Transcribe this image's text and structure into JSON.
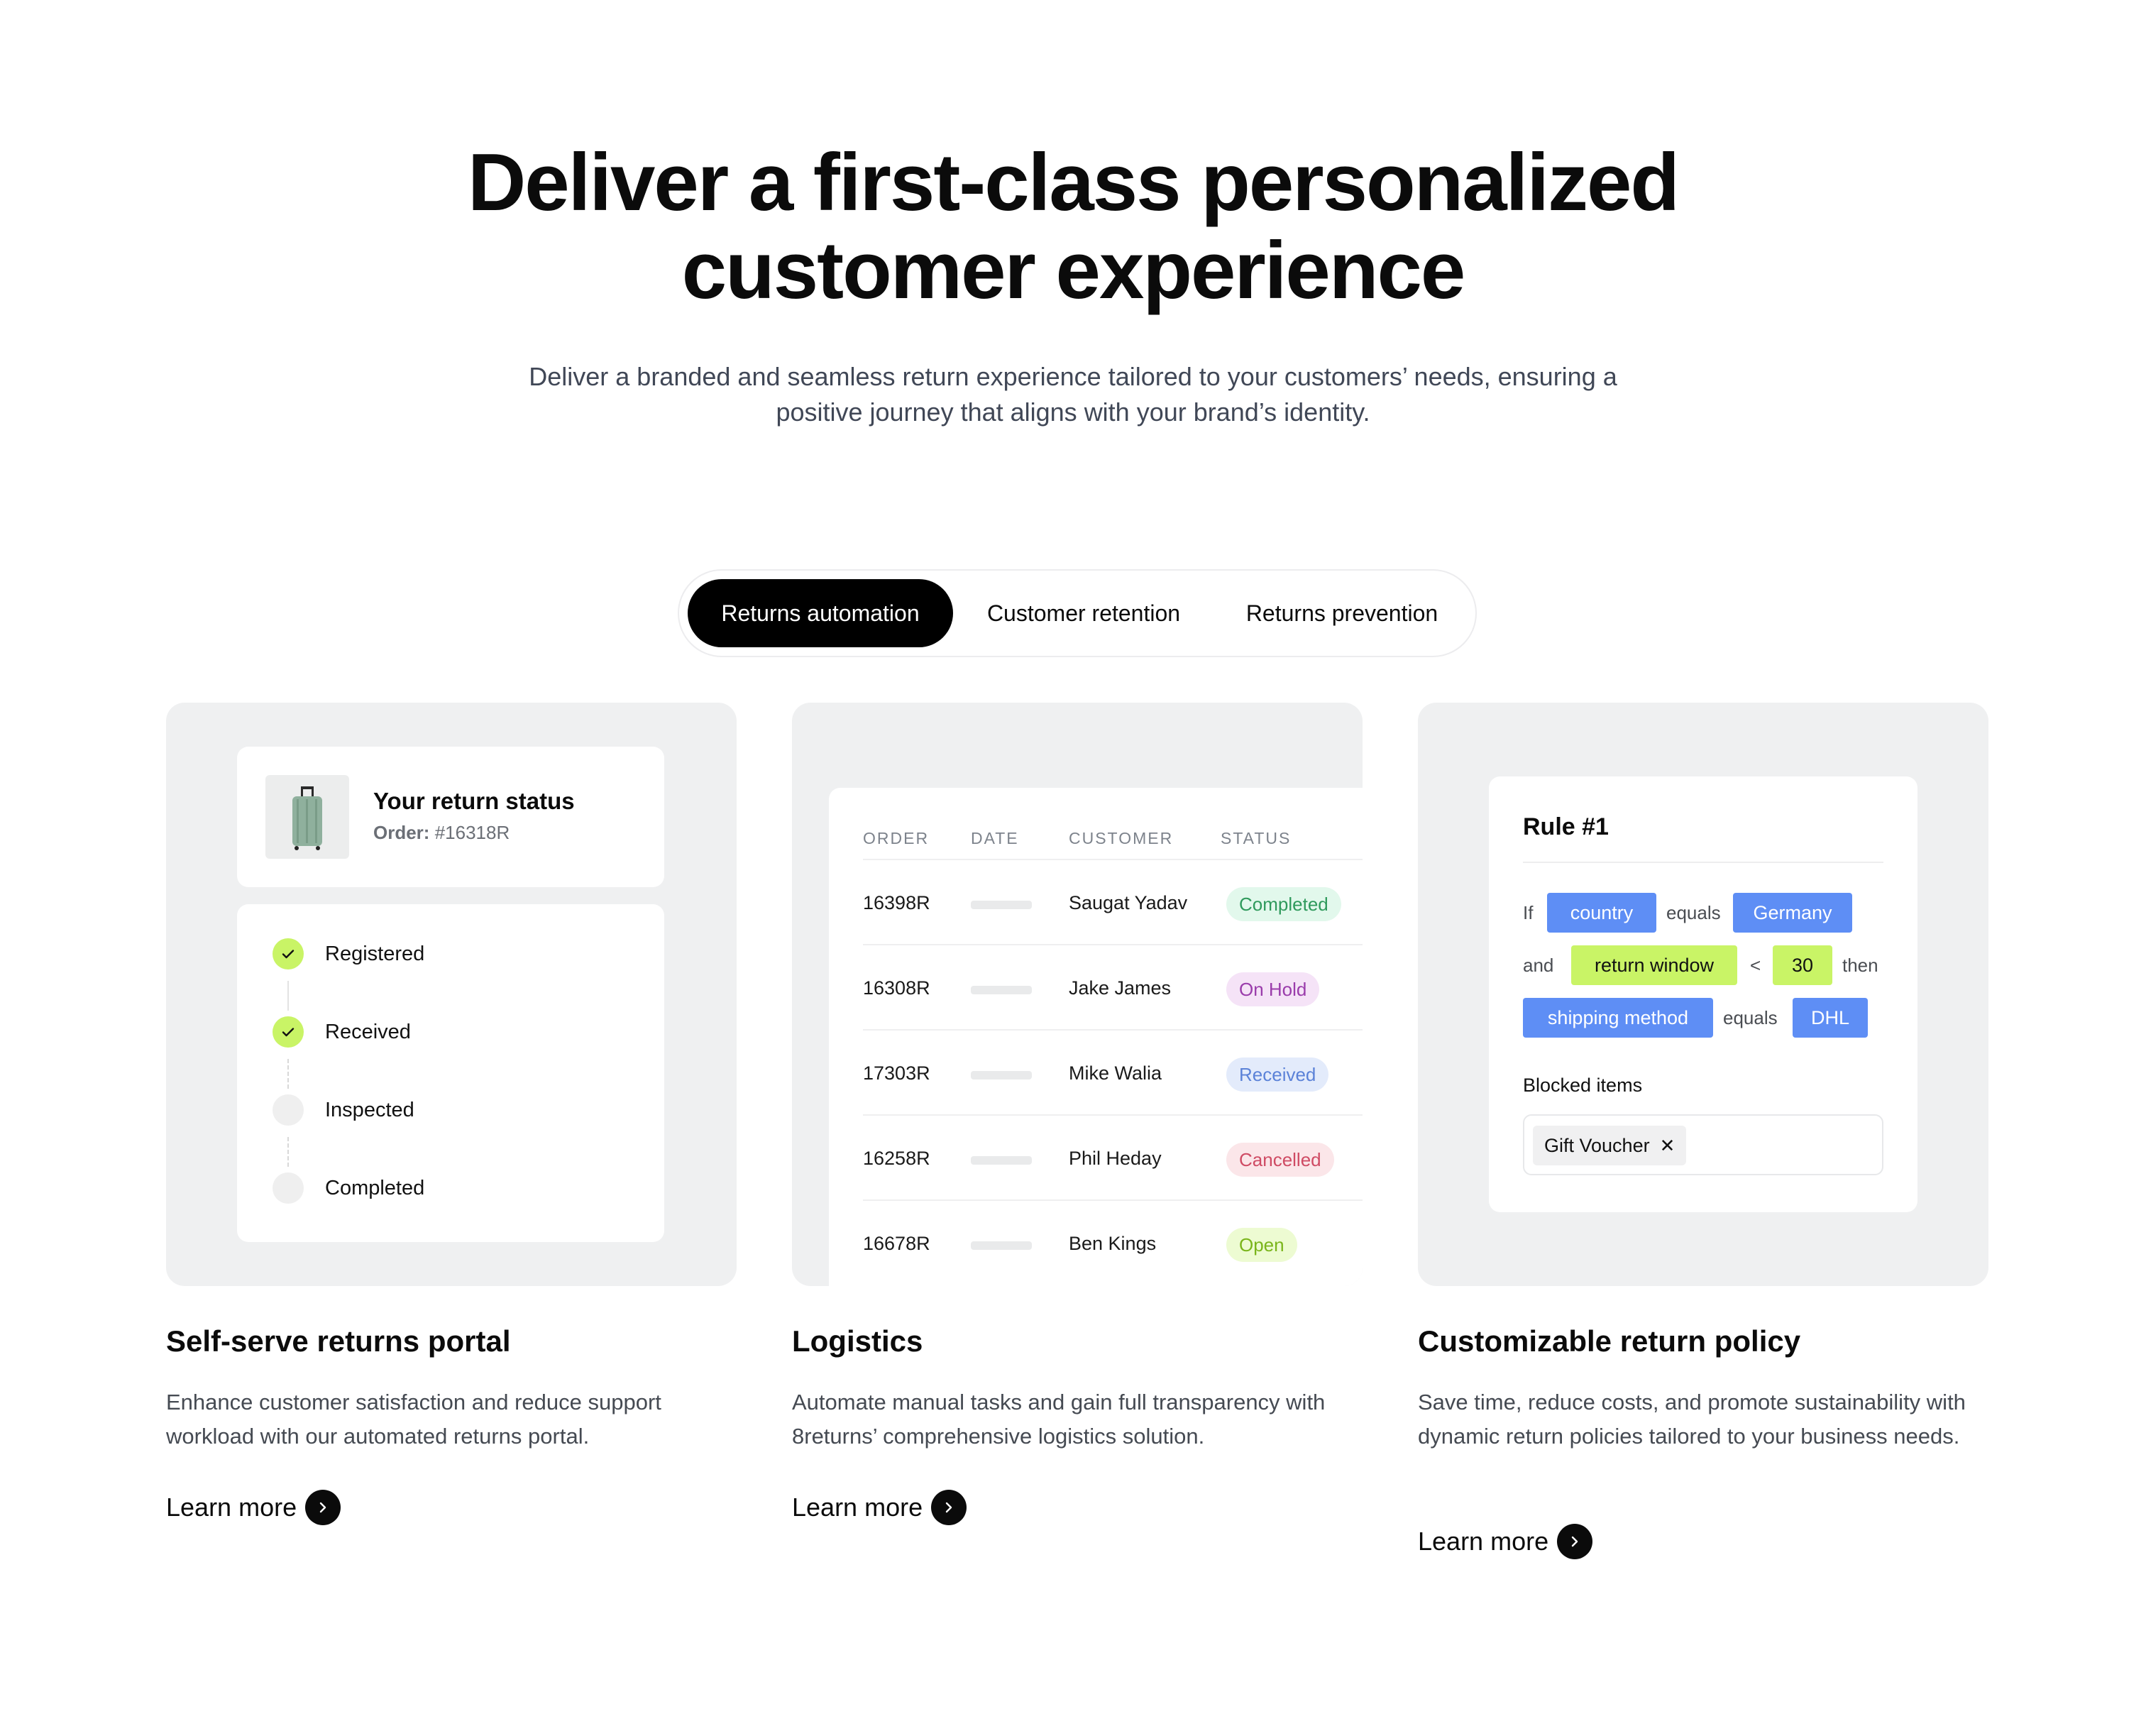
{
  "hero": {
    "title_line1": "Deliver a first-class personalized",
    "title_line2": "customer experience",
    "subtitle_line1": "Deliver a branded and seamless return experience tailored to your customers’ needs, ensuring a",
    "subtitle_line2": "positive journey that aligns with your brand’s identity."
  },
  "tabs": [
    {
      "label": "Returns automation",
      "active": true
    },
    {
      "label": "Customer retention",
      "active": false
    },
    {
      "label": "Returns prevention",
      "active": false
    }
  ],
  "portal": {
    "title": "Your return status",
    "order_label": "Order:",
    "order_number": "#16318R",
    "product_icon": "suitcase-icon",
    "steps": [
      {
        "label": "Registered",
        "done": true
      },
      {
        "label": "Received",
        "done": true
      },
      {
        "label": "Inspected",
        "done": false
      },
      {
        "label": "Completed",
        "done": false
      }
    ]
  },
  "logistics_table": {
    "headers": [
      "ORDER",
      "DATE",
      "CUSTOMER",
      "STATUS"
    ],
    "rows": [
      {
        "order": "16398R",
        "customer": "Saugat Yadav",
        "status": "Completed"
      },
      {
        "order": "16308R",
        "customer": "Jake James",
        "status": "On Hold"
      },
      {
        "order": "17303R",
        "customer": "Mike Walia",
        "status": "Received"
      },
      {
        "order": "16258R",
        "customer": "Phil Heday",
        "status": "Cancelled"
      },
      {
        "order": "16678R",
        "customer": "Ben Kings",
        "status": "Open"
      }
    ],
    "status_colors": {
      "Completed": {
        "bg": "#e2f8ec",
        "fg": "#2f9a5c"
      },
      "On Hold": {
        "bg": "#f5e3f7",
        "fg": "#9a3cab"
      },
      "Received": {
        "bg": "#e3ebfb",
        "fg": "#5b82d8"
      },
      "Cancelled": {
        "bg": "#fbe6e9",
        "fg": "#cf4b64"
      },
      "Open": {
        "bg": "#edfbd2",
        "fg": "#7ab51b"
      }
    }
  },
  "rule": {
    "title": "Rule #1",
    "row1": {
      "if": "If",
      "field": "country",
      "op": "equals",
      "value": "Germany"
    },
    "row2": {
      "and": "and",
      "field": "return window",
      "op": "<",
      "value": "30",
      "then": "then"
    },
    "row3": {
      "field": "shipping method",
      "op": "equals",
      "value": "DHL"
    },
    "blocked_label": "Blocked items",
    "blocked_tag": "Gift Voucher",
    "remove_glyph": "✕"
  },
  "features": [
    {
      "title": "Self-serve returns portal",
      "desc": "Enhance customer satisfaction and reduce support workload with our automated returns portal.",
      "cta": "Learn more"
    },
    {
      "title": "Logistics",
      "desc": "Automate manual tasks and gain full transparency with 8returns’ comprehensive logistics solution.",
      "cta": "Learn more"
    },
    {
      "title": "Customizable return policy",
      "desc": "Save time, reduce costs, and promote sustainability with dynamic return policies tailored to your business needs.",
      "cta": "Learn more"
    }
  ],
  "colors": {
    "accent_lime": "#c9f466",
    "accent_blue": "#5e8ef5",
    "tab_active_bg": "#000000"
  }
}
